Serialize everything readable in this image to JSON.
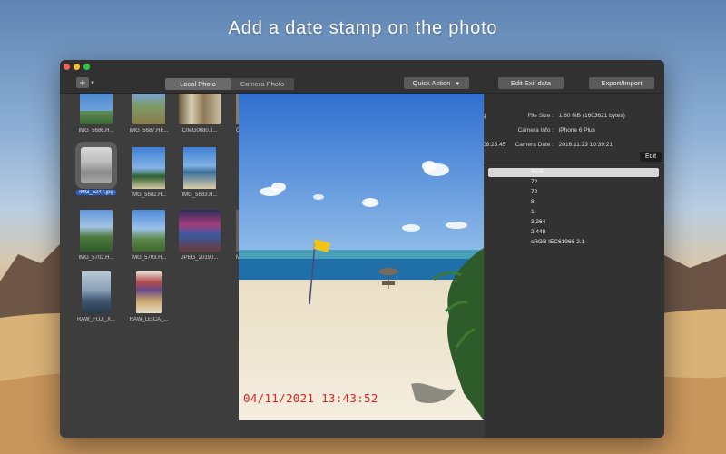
{
  "headline": "Add a date stamp on the photo",
  "toolbar": {
    "add_icon": "plus-icon",
    "tabs": [
      "Local Photo",
      "Camera Photo"
    ],
    "quick_action": "Quick Action",
    "quick_action_caret": "▼",
    "edit_exif": "Edit Exif data",
    "export_import": "Export/Import"
  },
  "library": {
    "items": [
      {
        "name": "IMG_5686.H..."
      },
      {
        "name": "IMG_5687.HE..."
      },
      {
        "name": "CIMG0680.J..."
      },
      {
        "name": "C"
      },
      {
        "name": "IMG_5247.jpg"
      },
      {
        "name": "IMG_5682.H..."
      },
      {
        "name": "IMG_5683.H..."
      },
      {
        "name": "IMG_5702.H..."
      },
      {
        "name": "IMG_5703.H..."
      },
      {
        "name": "JPEG_20190..."
      },
      {
        "name": "M"
      },
      {
        "name": "RAW_FUJI_X..."
      },
      {
        "name": "RAW_LEICA_..."
      }
    ]
  },
  "info": {
    "frag_g": "g",
    "file_size_label": "File Size :",
    "file_size_value": "1.60 MB (1603621 bytes)",
    "camera_info_label": "Camera Info :",
    "camera_info_value": "iPhone 6 Plus",
    "left_time": "08:25:45",
    "camera_date_label": "Camera Date :",
    "camera_date_value": "2016:11:23 10:39:21",
    "edit": "Edit",
    "values": [
      "RGB",
      "72",
      "72",
      "8",
      "1",
      "3,264",
      "2,448",
      "sRGB IEC61966-2.1"
    ]
  },
  "photo": {
    "date_stamp": "04/11/2021 13:43:52",
    "stamp_color": "#e42020"
  }
}
